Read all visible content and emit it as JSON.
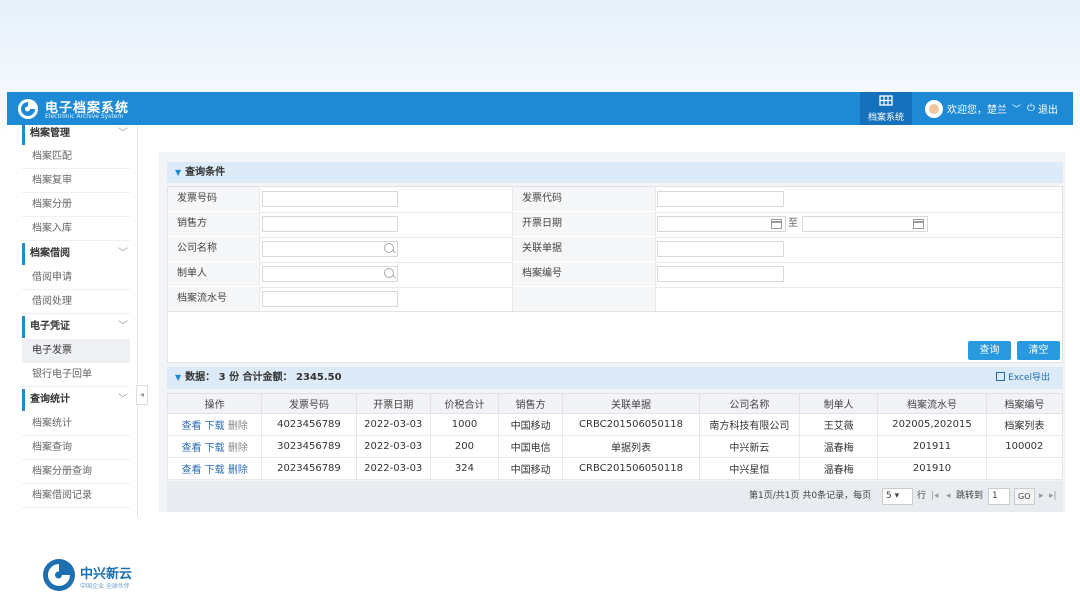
{
  "header": {
    "title": "电子档案系统",
    "subtitle": "Electronic Archive System",
    "sys_button": "档案系统",
    "welcome": "欢迎您，楚兰",
    "logout": "退出"
  },
  "sidebar": {
    "groups": [
      {
        "label": "档案管理",
        "items": [
          "档案匹配",
          "档案复审",
          "档案分册",
          "档案入库"
        ]
      },
      {
        "label": "档案借阅",
        "items": [
          "借阅申请",
          "借阅处理"
        ]
      },
      {
        "label": "电子凭证",
        "items": [
          "电子发票",
          "银行电子回单"
        ]
      },
      {
        "label": "查询统计",
        "items": [
          "档案统计",
          "档案查询",
          "档案分册查询",
          "档案借阅记录"
        ]
      }
    ],
    "active_item": "电子发票"
  },
  "query": {
    "title": "查询条件",
    "labels": {
      "invoice_no": "发票号码",
      "invoice_code": "发票代码",
      "seller": "销售方",
      "invoice_date": "开票日期",
      "date_to": "至",
      "company": "公司名称",
      "related_doc": "关联单据",
      "maker": "制单人",
      "archive_no": "档案编号",
      "archive_serial": "档案流水号"
    },
    "buttons": {
      "search": "查询",
      "clear": "清空"
    }
  },
  "results": {
    "summary": "数据：  3 份 合计金额：  2345.50",
    "excel_export": "Excel导出",
    "columns": [
      "操作",
      "发票号码",
      "开票日期",
      "价税合计",
      "销售方",
      "关联单据",
      "公司名称",
      "制单人",
      "档案流水号",
      "档案编号"
    ],
    "actions": {
      "view": "查看",
      "download": "下载",
      "delete": "删除"
    },
    "rows": [
      {
        "invoice_no": "4023456789",
        "date": "2022-03-03",
        "total": "1000",
        "seller": "中国移动",
        "related": "CRBC201506050118",
        "company": "南方科技有限公司",
        "maker": "王艾薇",
        "serial": "202005,202015",
        "archive": "档案列表"
      },
      {
        "invoice_no": "3023456789",
        "date": "2022-03-03",
        "total": "200",
        "seller": "中国电信",
        "related": "单据列表",
        "company": "中兴新云",
        "maker": "温春梅",
        "serial": "201911",
        "archive": "100002"
      },
      {
        "invoice_no": "2023456789",
        "date": "2022-03-03",
        "total": "324",
        "seller": "中国移动",
        "related": "CRBC201506050118",
        "company": "中兴星恒",
        "maker": "温春梅",
        "serial": "201910",
        "archive": ""
      }
    ]
  },
  "pager": {
    "info": "第1页/共1页 共0条记录，每页",
    "page_size": "5",
    "rows_label": "行",
    "goto_label": "跳转到",
    "goto_value": "1",
    "go": "GO"
  },
  "footer": {
    "brand": "中兴新云",
    "slogan": "中国企业 全球伙伴"
  },
  "colors": {
    "primary": "#1e8ad5",
    "link": "#2b6cb3"
  }
}
